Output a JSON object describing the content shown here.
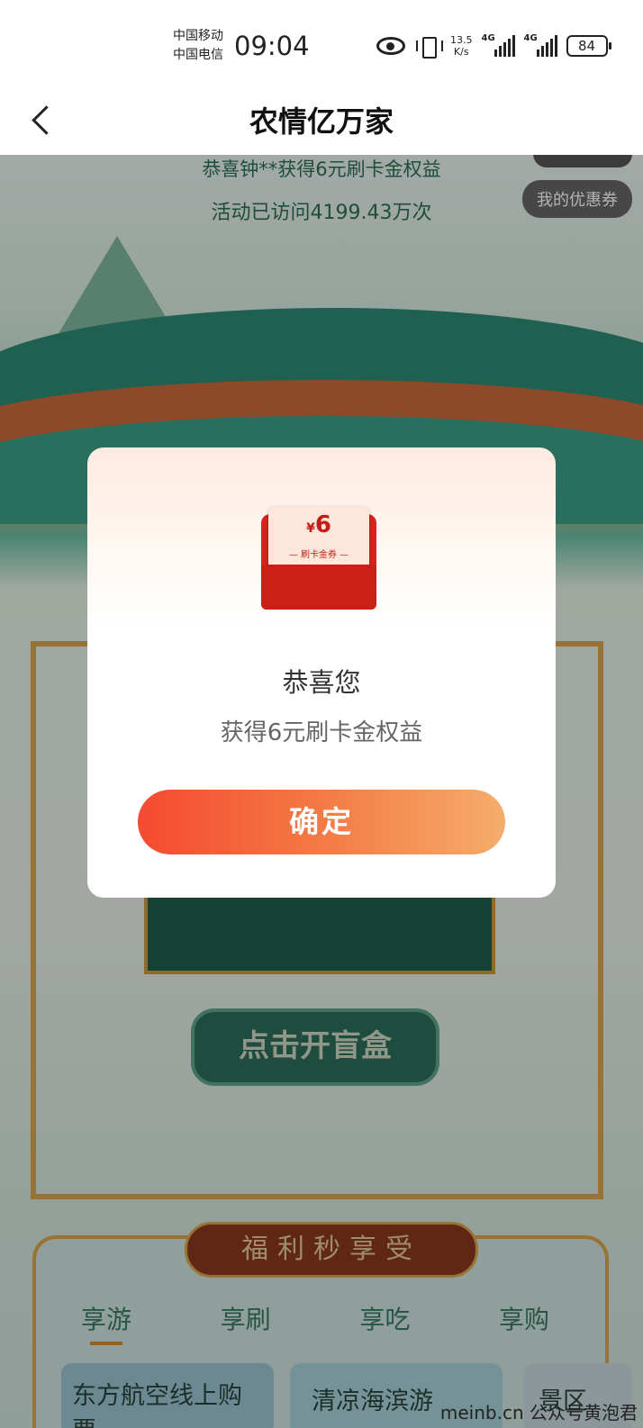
{
  "status": {
    "carrier1": "中国移动",
    "carrier2": "中国电信",
    "time": "09:04",
    "net_speed_value": "13.5",
    "net_speed_unit": "K/s",
    "sig1_label": "4G",
    "sig2_label": "4G",
    "battery": "84"
  },
  "nav": {
    "title": "农情亿万家"
  },
  "page": {
    "winner_text": "恭喜钟**获得6元刷卡金权益",
    "visits_text": "活动已访问4199.43万次",
    "coupon_button": "我的优惠券",
    "open_box_button": "点击开盲盒",
    "welfare_title": "福利秒享受",
    "tabs": [
      "享游",
      "享刷",
      "享吃",
      "享购"
    ],
    "cards": [
      "东方航空线上购票",
      "清凉海滨游",
      "景区"
    ]
  },
  "dialog": {
    "voucher_symbol": "¥",
    "voucher_amount": "6",
    "voucher_label": "— 刷卡金券 —",
    "title": "恭喜您",
    "message": "获得6元刷卡金权益",
    "confirm_button": "确定"
  },
  "watermark": "meinb.cn 公众号黄泡君",
  "colors": {
    "accent": "#f54a30",
    "accent_end": "#f5ad6c",
    "theme_green": "#2c6f56"
  }
}
